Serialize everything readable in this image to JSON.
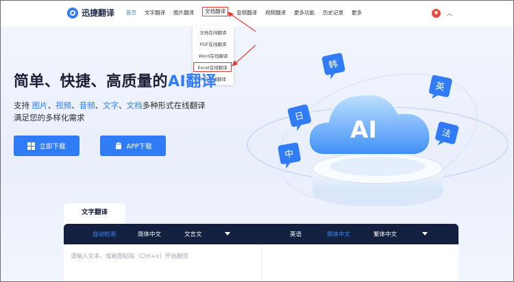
{
  "header": {
    "logo_text": "迅捷翻译",
    "nav": [
      "首页",
      "文字翻译",
      "图片翻译",
      "文档翻译",
      "音频翻译",
      "视频翻译",
      "更多功能",
      "历史记录",
      "更多"
    ]
  },
  "dropdown": {
    "items": [
      "文档在线翻译",
      "PDF在线翻译",
      "Word在线翻译",
      "Excel在线翻译",
      "PPT在线翻译"
    ]
  },
  "hero": {
    "title": "简单、快捷、高质量的",
    "title_ai": "AI翻译",
    "sub_prefix": "支持 ",
    "sub_links": [
      "图片",
      "视频",
      "音频",
      "文字",
      "文档"
    ],
    "sub_suffix": "多种形式在线翻译",
    "sub_line2": "满足您的多样化需求",
    "btn_download": "立即下载",
    "btn_app": "APP下载"
  },
  "illustration": {
    "cloud_label": "AI",
    "bubbles": [
      "韩",
      "英",
      "日",
      "法",
      "中"
    ]
  },
  "translator": {
    "tab": "文字翻译",
    "source_langs": [
      "自动检测",
      "简体中文",
      "文言文"
    ],
    "target_langs": [
      "英语",
      "简体中文",
      "繁体中文"
    ],
    "placeholder": "请输入文本，或截图粘贴（Ctrl+v）开始翻译"
  },
  "colors": {
    "accent": "#2f7cf6",
    "dark_bar": "#13203f",
    "highlight_box": "#e53935"
  }
}
